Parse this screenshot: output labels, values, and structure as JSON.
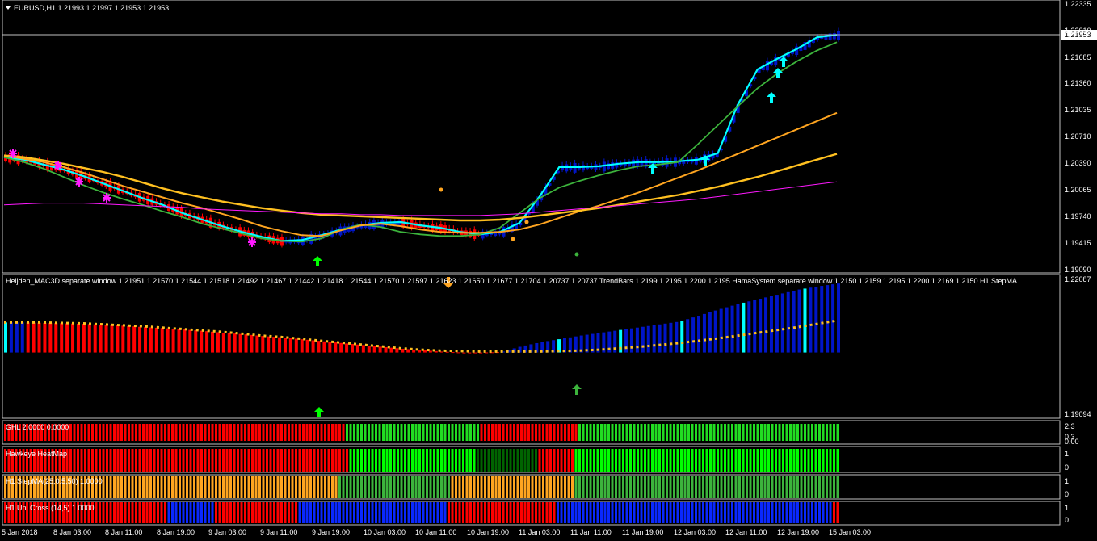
{
  "main": {
    "header": "EURUSD,H1  1.21993 1.21997 1.21953 1.21953",
    "price_ticks": [
      "1.22335",
      "1.22010",
      "1.21685",
      "1.21360",
      "1.21035",
      "1.20710",
      "1.20390",
      "1.20065",
      "1.19740",
      "1.19415",
      "1.19090"
    ],
    "current_price": "1.21953"
  },
  "macd": {
    "header": "Heijden_MAC3D separate window 1.21951 1.21570 1.21544 1.21518 1.21492 1.21467 1.21442 1.21418 1.21544 1.21570 1.21597 1.21623 1.21650 1.21677 1.21704 1.20737 1.20737  TrendBars 1.2199 1.2195 1.2200 1.2195  HamaSystem separate window 1.2150 1.2159 1.2195 1.2200 1.2169 1.2150  H1 StepMA",
    "ticks": [
      "1.22087",
      "1.19094"
    ]
  },
  "ghl": {
    "header": "GHL 2.0000 0.0000",
    "ticks": [
      "2.3",
      "0.3",
      "0.00"
    ]
  },
  "heatmap": {
    "header": "Hawkeye HeatMap",
    "ticks": [
      "1",
      "0"
    ]
  },
  "stepma": {
    "header": "H1 StepMA(25,0.5,50) 1.0000",
    "ticks": [
      "1",
      "0"
    ]
  },
  "unicross": {
    "header": "H1  Uni Cross (14,5) 1.0000",
    "ticks": [
      "1",
      "0"
    ]
  },
  "time_labels": [
    "5 Jan 2018",
    "8 Jan 03:00",
    "8 Jan 11:00",
    "8 Jan 19:00",
    "9 Jan 03:00",
    "9 Jan 11:00",
    "9 Jan 19:00",
    "10 Jan 03:00",
    "10 Jan 11:00",
    "10 Jan 19:00",
    "11 Jan 03:00",
    "11 Jan 11:00",
    "11 Jan 19:00",
    "12 Jan 03:00",
    "12 Jan 11:00",
    "12 Jan 19:00",
    "15 Jan 03:00"
  ],
  "colors": {
    "bull": "#0015c8",
    "bear": "#ff0000",
    "cyan": "#00ffff",
    "green": "#3cb43c",
    "orange": "#ffa520",
    "magenta": "#ff19ff",
    "lime": "#00ff00",
    "darkgreen": "#006400",
    "grid": "#c0c0c0"
  },
  "chart_data": [
    {
      "type": "line",
      "title": "EURUSD,H1",
      "x": "hourly bars, 5 Jan 2018 to 15 Jan 2018",
      "ylim": [
        1.1909,
        1.22335
      ],
      "series": [
        {
          "values": [
            1.2046,
            1.2043,
            1.2037,
            1.2031,
            1.2023,
            1.2014,
            1.2005,
            1.1996,
            1.1988,
            1.1978,
            1.197,
            1.1962,
            1.1955,
            1.1949,
            1.1944,
            1.1945,
            1.1951,
            1.1958,
            1.1963,
            1.1966,
            1.1967,
            1.1963,
            1.196,
            1.1955,
            1.1952,
            1.1955,
            1.1966,
            1.1998,
            1.2034,
            1.2034,
            1.2035,
            1.2038,
            1.204,
            1.204,
            1.2041,
            1.2043,
            1.2051,
            1.211,
            1.2153,
            1.2166,
            1.2178,
            1.2192,
            1.2195
          ]
        },
        {
          "values": [
            1.2046,
            1.204,
            1.2032,
            1.2022,
            1.2012,
            1.2003,
            1.1995,
            1.1988,
            1.198,
            1.1973,
            1.1965,
            1.1959,
            1.1953,
            1.1947,
            1.1944,
            1.1943,
            1.1947,
            1.1958,
            1.1964,
            1.1961,
            1.1955,
            1.1952,
            1.195,
            1.195,
            1.1952,
            1.196,
            1.1978,
            1.1996,
            1.2009,
            1.2017,
            1.2024,
            1.203,
            1.2035,
            1.2037,
            1.204,
            1.2062,
            1.2085,
            1.2108,
            1.213,
            1.2148,
            1.2163,
            1.2176,
            1.2186
          ]
        },
        {
          "values": [
            1.2048,
            1.2044,
            1.204,
            1.2034,
            1.2027,
            1.2019,
            1.2011,
            1.2004,
            1.1997,
            1.199,
            1.1984,
            1.1977,
            1.197,
            1.1962,
            1.1956,
            1.1951,
            1.195,
            1.1957,
            1.1963,
            1.1965,
            1.1962,
            1.1958,
            1.1955,
            1.1954,
            1.1954,
            1.1955,
            1.1958,
            1.1964,
            1.1972,
            1.198,
            1.1987,
            1.1995,
            1.2003,
            1.2012,
            1.2021,
            1.203,
            1.204,
            1.205,
            1.206,
            1.207,
            1.208,
            1.209,
            1.21
          ]
        },
        {
          "values": [
            1.2048,
            1.2046,
            1.2042,
            1.2038,
            1.2033,
            1.2028,
            1.2022,
            1.2015,
            1.2008,
            1.2002,
            1.1997,
            1.1992,
            1.1988,
            1.1984,
            1.1981,
            1.1978,
            1.1976,
            1.1975,
            1.1974,
            1.1973,
            1.1972,
            1.1971,
            1.197,
            1.1969,
            1.1969,
            1.197,
            1.1972,
            1.1975,
            1.1978,
            1.1981,
            1.1984,
            1.1988,
            1.1992,
            1.1996,
            1.2,
            1.2005,
            1.201,
            1.2016,
            1.2022,
            1.2029,
            1.2036,
            1.2043,
            1.205
          ]
        },
        {
          "values": [
            1.1988,
            1.1989,
            1.199,
            1.199,
            1.199,
            1.1989,
            1.1988,
            1.1987,
            1.1986,
            1.1985,
            1.1983,
            1.1982,
            1.1981,
            1.198,
            1.1979,
            1.1978,
            1.1977,
            1.1977,
            1.1976,
            1.1976,
            1.1975,
            1.1975,
            1.1975,
            1.1975,
            1.1975,
            1.1976,
            1.1977,
            1.1979,
            1.1981,
            1.1983,
            1.1985,
            1.1987,
            1.1989,
            1.1991,
            1.1993,
            1.1995,
            1.1998,
            1.2001,
            1.2004,
            1.2007,
            1.201,
            1.2013,
            1.2016
          ]
        }
      ]
    },
    {
      "type": "bar",
      "title": "Heijden_MAC3D",
      "ylim": [
        1.19094,
        1.22087
      ],
      "series": [
        {
          "values": [
            1.211,
            1.211,
            1.2109,
            1.2108,
            1.2107,
            1.2105,
            1.2103,
            1.21,
            1.2098,
            1.2095,
            1.2092,
            1.2088,
            1.2085,
            1.2081,
            1.2078,
            1.2074,
            1.207,
            1.2066,
            1.2062,
            1.2058,
            1.2054,
            1.2051,
            1.2048,
            1.2046,
            1.2046,
            1.2047,
            1.2059,
            1.2068,
            1.2075,
            1.2082,
            1.2088,
            1.2094,
            1.21,
            1.2106,
            1.2112,
            1.2125,
            1.2138,
            1.215,
            1.216,
            1.217,
            1.218,
            1.2187,
            1.2193
          ]
        },
        {
          "values": [
            1.211,
            1.211,
            1.211,
            1.2109,
            1.2108,
            1.2106,
            1.2104,
            1.2102,
            1.2099,
            1.2096,
            1.2093,
            1.209,
            1.2086,
            1.2082,
            1.2079,
            1.2075,
            1.2071,
            1.2067,
            1.2063,
            1.2059,
            1.2055,
            1.2052,
            1.205,
            1.2049,
            1.2048,
            1.2048,
            1.2048,
            1.2048,
            1.2049,
            1.205,
            1.2052,
            1.2055,
            1.2058,
            1.2062,
            1.2066,
            1.2071,
            1.2076,
            1.2082,
            1.2088,
            1.2094,
            1.21,
            1.2107,
            1.2114
          ]
        }
      ]
    }
  ]
}
